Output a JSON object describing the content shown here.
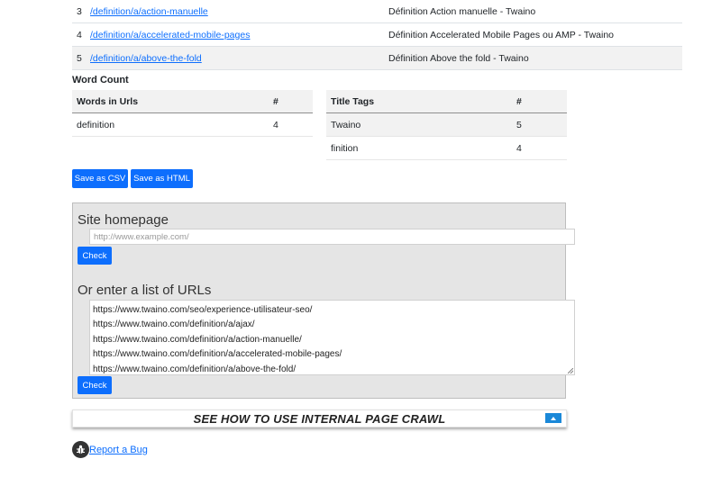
{
  "results": [
    {
      "num": "3",
      "url": "/definition/a/action-manuelle",
      "title": "Définition Action manuelle - Twaino"
    },
    {
      "num": "4",
      "url": "/definition/a/accelerated-mobile-pages",
      "title": "Définition Accelerated Mobile Pages ou AMP  - Twaino"
    },
    {
      "num": "5",
      "url": "/definition/a/above-the-fold",
      "title": "Définition Above the fold - Twaino"
    }
  ],
  "word_count": {
    "label": "Word Count",
    "urls": {
      "header": "Words in Urls",
      "count_header": "#",
      "rows": [
        {
          "word": "definition",
          "count": "4"
        }
      ]
    },
    "titles": {
      "header": "Title Tags",
      "count_header": "#",
      "rows": [
        {
          "word": "Twaino",
          "count": "5"
        },
        {
          "word": "finition",
          "count": "4"
        }
      ]
    }
  },
  "export": {
    "csv_label": "Save as CSV",
    "html_label": "Save as HTML"
  },
  "form": {
    "homepage_heading": "Site homepage",
    "homepage_placeholder": "http://www.example.com/",
    "check_label": "Check",
    "list_heading": "Or enter a list of URLs",
    "url_list": [
      "https://www.twaino.com/seo/experience-utilisateur-seo/",
      "https://www.twaino.com/definition/a/ajax/",
      "https://www.twaino.com/definition/a/action-manuelle/",
      "https://www.twaino.com/definition/a/accelerated-mobile-pages/",
      "https://www.twaino.com/definition/a/above-the-fold/"
    ]
  },
  "howto": {
    "label": "SEE HOW TO USE INTERNAL PAGE CRAWL"
  },
  "footer": {
    "bug_label": "Report a Bug",
    "bug_icon": "bug-icon"
  },
  "colors": {
    "accent": "#0d6efd",
    "toggle": "#1a88d8",
    "panel_bg": "#e5e5e5"
  }
}
